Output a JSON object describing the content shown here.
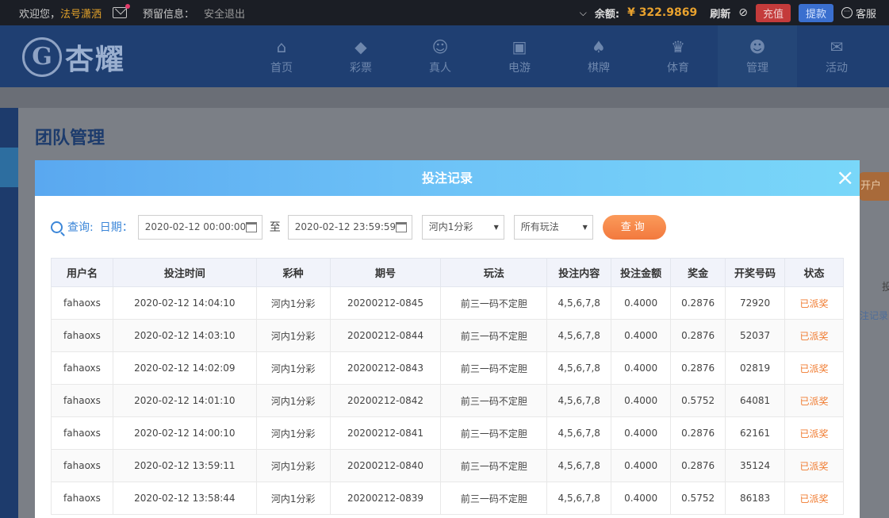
{
  "topbar": {
    "welcome": "欢迎您，",
    "username": "法号潇洒",
    "reserve_label": "预留信息：",
    "logout": "安全退出",
    "chevron": "⌵",
    "balance_label": "余额:",
    "balance_value": "¥ 322.9869",
    "refresh": "刷新",
    "recharge": "充值",
    "withdraw": "提款",
    "service": "客服",
    "colors": {
      "bg": "#1b1e25",
      "accent": "#e9a22e",
      "recharge": "#c43b3b",
      "withdraw": "#3a6fcf"
    }
  },
  "logo": {
    "mark": "G",
    "text": "杏耀"
  },
  "nav": {
    "items": [
      {
        "label": "首页",
        "icon": "home-icon",
        "glyph": "⌂"
      },
      {
        "label": "彩票",
        "icon": "lottery-icon",
        "glyph": "◆"
      },
      {
        "label": "真人",
        "icon": "live-dealer-icon",
        "glyph": "☺"
      },
      {
        "label": "电游",
        "icon": "slot-machine-icon",
        "glyph": "▣"
      },
      {
        "label": "棋牌",
        "icon": "cards-icon",
        "glyph": "♠"
      },
      {
        "label": "体育",
        "icon": "trophy-icon",
        "glyph": "♛"
      },
      {
        "label": "管理",
        "icon": "users-icon",
        "glyph": "☻"
      },
      {
        "label": "活动",
        "icon": "gift-icon",
        "glyph": "✉"
      }
    ]
  },
  "page": {
    "title": "团队管理",
    "side_button": "开户",
    "side_link": "注记录",
    "side_char": "投"
  },
  "modal": {
    "title": "投注记录",
    "close": "×",
    "query_label": "查询:",
    "date_label": "日期：",
    "start_date": "2020-02-12 00:00:00",
    "to": "至",
    "end_date": "2020-02-12 23:59:59",
    "lottery_select": "河内1分彩",
    "play_select": "所有玩法",
    "query_button": "查询"
  },
  "table": {
    "headers": [
      "用户名",
      "投注时间",
      "彩种",
      "期号",
      "玩法",
      "投注内容",
      "投注金额",
      "奖金",
      "开奖号码",
      "状态"
    ],
    "rows": [
      [
        "fahaoxs",
        "2020-02-12 14:04:10",
        "河内1分彩",
        "20200212-0845",
        "前三一码不定胆",
        "4,5,6,7,8",
        "0.4000",
        "0.2876",
        "72920",
        "已派奖"
      ],
      [
        "fahaoxs",
        "2020-02-12 14:03:10",
        "河内1分彩",
        "20200212-0844",
        "前三一码不定胆",
        "4,5,6,7,8",
        "0.4000",
        "0.2876",
        "52037",
        "已派奖"
      ],
      [
        "fahaoxs",
        "2020-02-12 14:02:09",
        "河内1分彩",
        "20200212-0843",
        "前三一码不定胆",
        "4,5,6,7,8",
        "0.4000",
        "0.2876",
        "02819",
        "已派奖"
      ],
      [
        "fahaoxs",
        "2020-02-12 14:01:10",
        "河内1分彩",
        "20200212-0842",
        "前三一码不定胆",
        "4,5,6,7,8",
        "0.4000",
        "0.5752",
        "64081",
        "已派奖"
      ],
      [
        "fahaoxs",
        "2020-02-12 14:00:10",
        "河内1分彩",
        "20200212-0841",
        "前三一码不定胆",
        "4,5,6,7,8",
        "0.4000",
        "0.2876",
        "62161",
        "已派奖"
      ],
      [
        "fahaoxs",
        "2020-02-12 13:59:11",
        "河内1分彩",
        "20200212-0840",
        "前三一码不定胆",
        "4,5,6,7,8",
        "0.4000",
        "0.2876",
        "35124",
        "已派奖"
      ],
      [
        "fahaoxs",
        "2020-02-12 13:58:44",
        "河内1分彩",
        "20200212-0839",
        "前三一码不定胆",
        "4,5,6,7,8",
        "0.4000",
        "0.5752",
        "86183",
        "已派奖"
      ]
    ]
  }
}
